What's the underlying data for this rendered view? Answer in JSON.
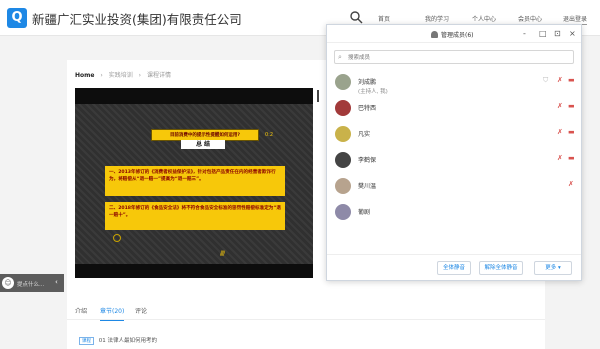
{
  "header": {
    "logo_letter": "Q",
    "org_name": "新疆广汇实业投资(集团)有限责任公司",
    "search_icon": "search-icon",
    "nav": [
      {
        "label": "首页"
      },
      {
        "label": "我的学习"
      },
      {
        "label": "个人中心"
      },
      {
        "label": "会员中心"
      },
      {
        "label": "退出登录"
      }
    ]
  },
  "page": {
    "breadcrumb": [
      "Home",
      "实践培训",
      "课程详情"
    ],
    "tabs": [
      "介绍",
      "章节(20)",
      "评论"
    ],
    "active_tab": "章节(20)",
    "chapter": {
      "tag": "课程",
      "title": "01 法律人最如何用考的"
    }
  },
  "slide": {
    "title": "目前消费中的提示性提醒如何运用?",
    "page": "0:2",
    "subtitle": "总 结",
    "box1": "一、2013年修订的《消费者权益保护法》，针对包括产品责任在内的经营者欺诈行为，将赔偿从“退一赔一”提高为“退一赔三”。",
    "box2": "二、2018年修订的《食品安全法》将不符合食品安全标准的惩罚性赔偿标准定为“退一赔十”。"
  },
  "ask_bar": {
    "text": "提点什么...",
    "icon": "chat-icon",
    "arrow": "‹"
  },
  "panel": {
    "title": "管理成员(6)",
    "title_icon": "user-group-icon",
    "window_controls": [
      "-",
      "□",
      "⊡",
      "×"
    ],
    "search_placeholder": "搜索成员",
    "members": [
      {
        "name": "刘成鹏",
        "sub": "(主持人, 我)",
        "avatar_color": "#9aa38d",
        "has_shield": true,
        "has_mic": true,
        "has_cam": true
      },
      {
        "name": "巴特西",
        "sub": "",
        "avatar_color": "#a23a3a",
        "has_shield": false,
        "has_mic": true,
        "has_cam": true
      },
      {
        "name": "凡实",
        "sub": "",
        "avatar_color": "#c9b24a",
        "has_shield": false,
        "has_mic": true,
        "has_cam": true
      },
      {
        "name": "李鹤保",
        "sub": "",
        "avatar_color": "#444444",
        "has_shield": false,
        "has_mic": true,
        "has_cam": true
      },
      {
        "name": "樊川温",
        "sub": "",
        "avatar_color": "#b7a38e",
        "has_shield": false,
        "has_mic": false,
        "has_cam": true
      },
      {
        "name": "葡剧",
        "sub": "",
        "avatar_color": "#8e8aa8",
        "has_shield": false,
        "has_mic": false,
        "has_cam": false
      }
    ],
    "footer": {
      "mute_all": "全体静音",
      "unmute_all": "解除全体静音",
      "more": "更多 ▾"
    }
  }
}
